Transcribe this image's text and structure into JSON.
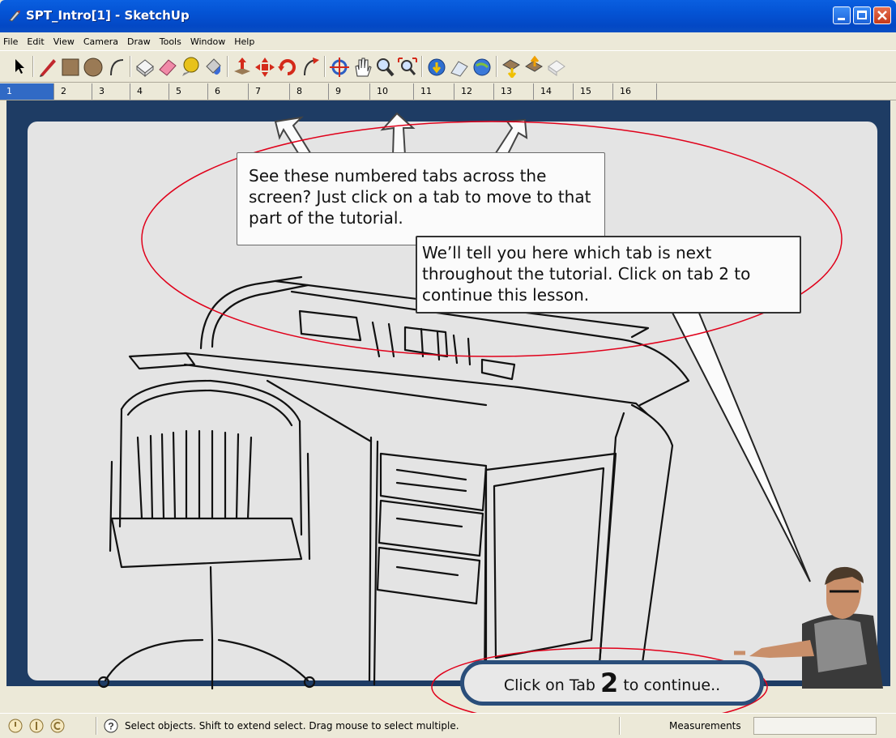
{
  "window": {
    "title": "SPT_Intro[1] - SketchUp"
  },
  "menu": [
    "File",
    "Edit",
    "View",
    "Camera",
    "Draw",
    "Tools",
    "Window",
    "Help"
  ],
  "toolbar": {
    "tools": [
      "select-tool",
      "pencil-tool",
      "rectangle-tool",
      "circle-tool",
      "arc-tool",
      "make-component-tool",
      "eraser-tool",
      "tape-measure-tool",
      "paint-bucket-tool",
      "push-pull-tool",
      "move-tool",
      "rotate-tool",
      "follow-me-tool",
      "orbit-tool",
      "pan-tool",
      "zoom-tool",
      "zoom-extents-tool",
      "get-models-tool",
      "share-model-tool",
      "google-earth-tool",
      "import-component-tool",
      "share-component-tool",
      "dynamic-components-tool"
    ]
  },
  "scenes": [
    "1",
    "2",
    "3",
    "4",
    "5",
    "6",
    "7",
    "8",
    "9",
    "10",
    "11",
    "12",
    "13",
    "14",
    "15",
    "16"
  ],
  "active_scene": "1",
  "callouts": {
    "top": "See these numbered tabs across the screen? Just click on a tab to move to that part of the tutorial.",
    "right": "We’ll tell you here which tab is next throughout the tutorial. Click on tab 2 to continue this lesson."
  },
  "continue": {
    "before": "Click on Tab ",
    "number": "2",
    "after": " to continue.."
  },
  "status": {
    "hint": "Select objects. Shift to extend select. Drag mouse to select multiple.",
    "measurements_label": "Measurements",
    "measurements_value": ""
  },
  "colors": {
    "titlebar": "#0453d4",
    "viewport_bg": "#1e3c64",
    "stage": "#e4e4e4",
    "annotation": "#e0001a",
    "active_tab": "#316ac5"
  }
}
